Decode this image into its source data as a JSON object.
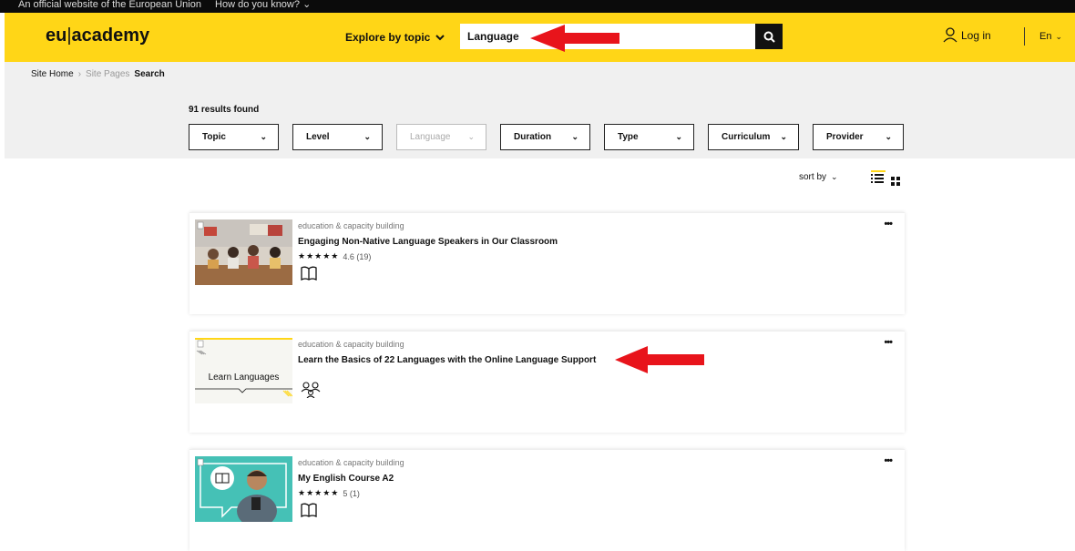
{
  "eu_bar": {
    "text": "An official website of the European Union",
    "question": "How do you know?"
  },
  "header": {
    "logo_left": "eu",
    "logo_sep": "|",
    "logo_right": "academy",
    "explore_label": "Explore by topic",
    "search_value": "Language",
    "login_label": "Log in",
    "language": "En"
  },
  "breadcrumb": {
    "home": "Site Home",
    "pages": "Site Pages",
    "current": "Search"
  },
  "results": {
    "count_text": "91 results found"
  },
  "filters": [
    {
      "label": "Topic",
      "disabled": false
    },
    {
      "label": "Level",
      "disabled": false
    },
    {
      "label": "Language",
      "disabled": true
    },
    {
      "label": "Duration",
      "disabled": false
    },
    {
      "label": "Type",
      "disabled": false
    },
    {
      "label": "Curriculum",
      "disabled": false
    },
    {
      "label": "Provider",
      "disabled": false
    }
  ],
  "sort": {
    "label": "sort by"
  },
  "cards": [
    {
      "category": "education & capacity building",
      "title": "Engaging Non-Native Language Speakers in Our Classroom",
      "stars": "★★★★★",
      "rating": "4.6 (19)",
      "type_icon": "book-icon"
    },
    {
      "category": "education & capacity building",
      "title": "Learn the Basics of 22 Languages with the Online Language Support",
      "thumb_text": "Learn Languages",
      "type_icon": "people-icon"
    },
    {
      "category": "education & capacity building",
      "title": "My English Course A2",
      "stars": "★★★★★",
      "rating": "5 (1)",
      "type_icon": "book-icon"
    }
  ],
  "colors": {
    "brand_yellow": "#ffd617",
    "arrow_red": "#e8141b",
    "dark": "#111111"
  }
}
